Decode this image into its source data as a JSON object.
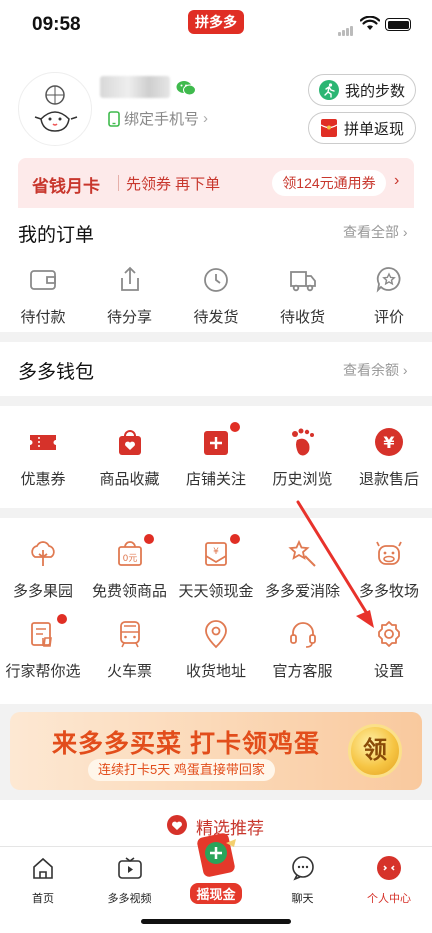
{
  "status": {
    "time": "09:58",
    "brand": "拼多多"
  },
  "profile": {
    "bind_phone": "绑定手机号",
    "steps_btn": "我的步数",
    "refund_btn": "拼单返现"
  },
  "savecard": {
    "title": "省钱月卡",
    "sub": "先领券 再下单",
    "cta": "领124元通用券"
  },
  "orders": {
    "title": "我的订单",
    "more": "查看全部",
    "items": [
      {
        "label": "待付款",
        "icon": "wallet-icon"
      },
      {
        "label": "待分享",
        "icon": "share-icon"
      },
      {
        "label": "待发货",
        "icon": "clock-icon"
      },
      {
        "label": "待收货",
        "icon": "truck-icon"
      },
      {
        "label": "评价",
        "icon": "review-icon"
      }
    ]
  },
  "wallet": {
    "title": "多多钱包",
    "more": "查看余额"
  },
  "shortcuts": {
    "items": [
      {
        "label": "优惠券",
        "icon": "coupon-icon"
      },
      {
        "label": "商品收藏",
        "icon": "favorite-bag-icon"
      },
      {
        "label": "店铺关注",
        "icon": "store-follow-icon"
      },
      {
        "label": "历史浏览",
        "icon": "footprint-icon"
      },
      {
        "label": "退款售后",
        "icon": "refund-icon"
      }
    ]
  },
  "services": {
    "row1": [
      {
        "label": "多多果园",
        "icon": "tree-icon"
      },
      {
        "label": "免费领商品",
        "icon": "free-goods-icon"
      },
      {
        "label": "天天领现金",
        "icon": "cash-envelope-icon"
      },
      {
        "label": "多多爱消除",
        "icon": "star-wand-icon"
      },
      {
        "label": "多多牧场",
        "icon": "cow-icon"
      }
    ],
    "row2": [
      {
        "label": "行家帮你选",
        "icon": "expert-pick-icon"
      },
      {
        "label": "火车票",
        "icon": "train-icon"
      },
      {
        "label": "收货地址",
        "icon": "location-icon"
      },
      {
        "label": "官方客服",
        "icon": "headset-icon"
      },
      {
        "label": "设置",
        "icon": "gear-icon"
      }
    ]
  },
  "banner": {
    "headline": "来多多买菜 打卡领鸡蛋",
    "sub": "连续打卡5天 鸡蛋直接带回家",
    "coin": "领"
  },
  "recommend": {
    "label": "精选推荐"
  },
  "tabbar": {
    "items": [
      {
        "label": "首页",
        "icon": "home-icon"
      },
      {
        "label": "多多视频",
        "icon": "video-icon"
      },
      {
        "label": "摇现金",
        "icon": "shake-cash-icon"
      },
      {
        "label": "聊天",
        "icon": "chat-icon"
      },
      {
        "label": "个人中心",
        "icon": "profile-icon"
      }
    ]
  },
  "colors": {
    "accent": "#e02e24",
    "icon_gray": "#8a8a8a"
  }
}
